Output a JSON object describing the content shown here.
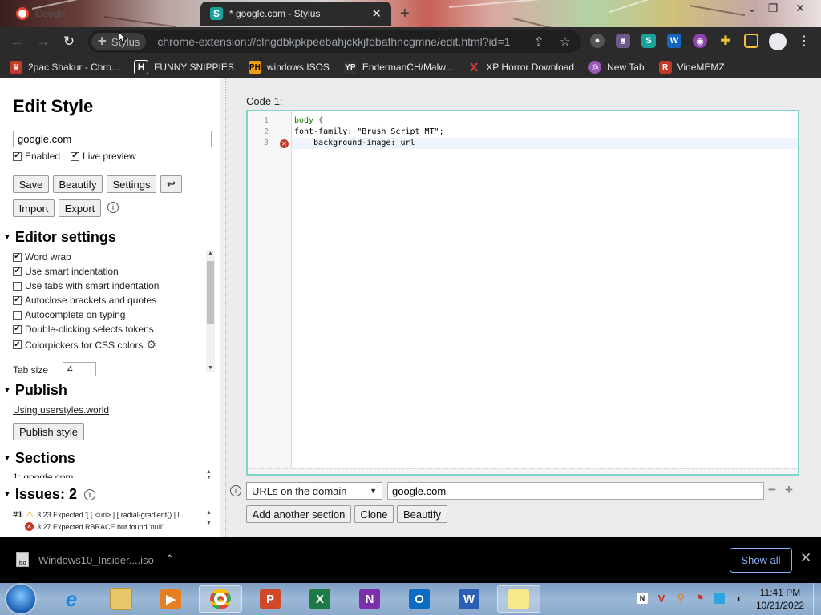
{
  "browser": {
    "tabs": [
      {
        "title": "Google",
        "active": false
      },
      {
        "title": "* google.com - Stylus",
        "active": true
      }
    ],
    "omnibox": {
      "site_chip": "Stylus",
      "url": "chrome-extension://clngdbkpkpeebahjckkjfobafhncgmne/edit.html?id=1"
    },
    "bookmarks": [
      {
        "label": "2pac Shakur - Chro...",
        "icon": "tupac-icon",
        "color": "#c0392b"
      },
      {
        "label": "FUNNY SNIPPIES",
        "icon": "h-icon",
        "color": "#444444"
      },
      {
        "label": "windows ISOS",
        "icon": "ph-icon",
        "color": "#f39c12"
      },
      {
        "label": "EndermanCH/Malw...",
        "icon": "yp-icon",
        "color": "#333333"
      },
      {
        "label": "XP Horror Download",
        "icon": "x-icon",
        "color": "#e53935"
      },
      {
        "label": "New Tab",
        "icon": "globe-icon",
        "color": "#9b59b6"
      },
      {
        "label": "VineMEMZ",
        "icon": "r-icon",
        "color": "#c0392b"
      }
    ]
  },
  "editor_panel": {
    "title": "Edit Style",
    "style_name": "google.com",
    "enabled_label": "Enabled",
    "live_preview_label": "Live preview",
    "buttons": {
      "save": "Save",
      "beautify": "Beautify",
      "settings": "Settings",
      "undo": "↩",
      "import": "Import",
      "export": "Export"
    },
    "editor_settings": {
      "heading": "Editor settings",
      "options": [
        {
          "label": "Word wrap",
          "checked": true
        },
        {
          "label": "Use smart indentation",
          "checked": true
        },
        {
          "label": "Use tabs with smart indentation",
          "checked": false
        },
        {
          "label": "Autoclose brackets and quotes",
          "checked": true
        },
        {
          "label": "Autocomplete on typing",
          "checked": false
        },
        {
          "label": "Double-clicking selects tokens",
          "checked": true
        },
        {
          "label": "Colorpickers for CSS colors",
          "checked": true
        }
      ],
      "tab_size_label": "Tab size",
      "tab_size_value": "4"
    },
    "publish": {
      "heading": "Publish",
      "link": "Using userstyles.world",
      "button": "Publish style"
    },
    "sections": {
      "heading": "Sections",
      "first_item": "1: google.com"
    },
    "issues": {
      "heading": "Issues: 2",
      "items": [
        {
          "id": "#1",
          "type": "warning",
          "text": "3:23  Expected '[ [ <uri> | [ radial-gradient() | li"
        },
        {
          "id": "",
          "type": "error",
          "text": "3:27  Expected RBRACE but found 'null'."
        }
      ]
    }
  },
  "code": {
    "label": "Code 1:",
    "lines": [
      {
        "n": "1",
        "text": "body {"
      },
      {
        "n": "2",
        "text": "font-family: \"Brush Script MT\";"
      },
      {
        "n": "3",
        "text": "    background-image: url"
      }
    ]
  },
  "applies": {
    "type": "URLs on the domain",
    "value": "google.com",
    "add_section": "Add another section",
    "clone": "Clone",
    "beautify": "Beautify"
  },
  "downloads": {
    "file": "Windows10_Insider....iso",
    "icon_text": "iso",
    "show_all": "Show all"
  },
  "taskbar": {
    "time": "11:41 PM",
    "date": "10/21/2022"
  }
}
